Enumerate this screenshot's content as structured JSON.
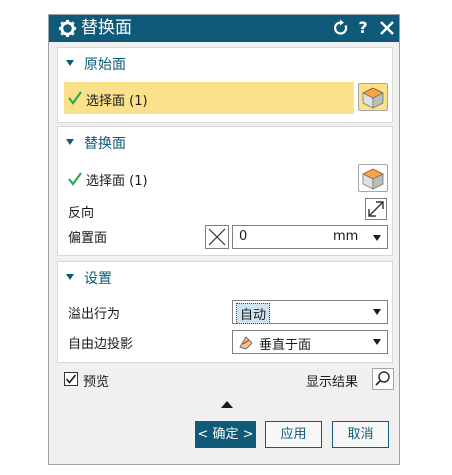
{
  "dialog": {
    "title": "替换面",
    "controls": {
      "reset": "reset-icon",
      "help": "?",
      "close": "close-icon"
    }
  },
  "original_face": {
    "header": "原始面",
    "select_label": "选择面 (1)"
  },
  "replace_face": {
    "header": "替换面",
    "select_label": "选择面 (1)",
    "reverse_label": "反向",
    "offset_label": "偏置面",
    "offset_value": "0",
    "offset_unit": "mm"
  },
  "settings": {
    "header": "设置",
    "overflow_label": "溢出行为",
    "overflow_value": "自动",
    "edge_projection_label": "自由边投影",
    "edge_projection_value": "垂直于面"
  },
  "footer": {
    "preview_label": "预览",
    "preview_checked": true,
    "show_result_label": "显示结果",
    "ok_label": "< 确定 >",
    "apply_label": "应用",
    "cancel_label": "取消"
  },
  "colors": {
    "title_bar": "#0f5a78",
    "accent": "#0f5a78",
    "selected_row": "#fbe28a",
    "check": "#2fa84f",
    "cube_top": "#f7a34a"
  }
}
